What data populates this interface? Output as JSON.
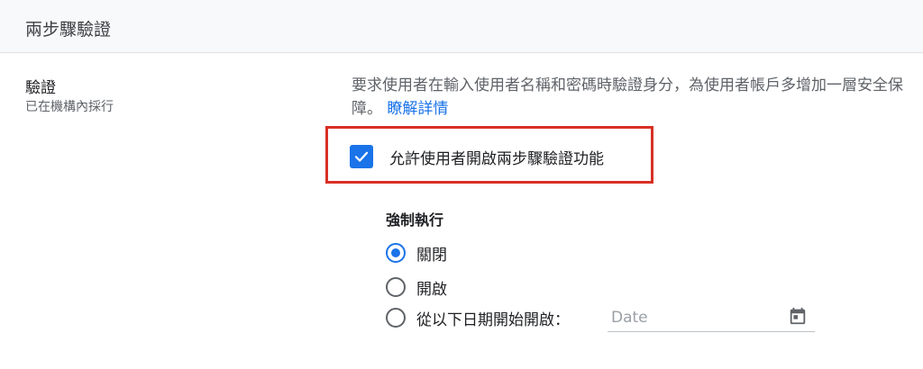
{
  "header": {
    "title": "兩步驟驗證"
  },
  "setting": {
    "name": "驗證",
    "status": "已在機構內採行",
    "description": "要求使用者在輸入使用者名稱和密碼時驗證身分，為使用者帳戶多增加一層安全保障。",
    "learn_more": "瞭解詳情"
  },
  "allow_checkbox": {
    "label": "允許使用者開啟兩步驟驗證功能",
    "checked": true
  },
  "enforcement": {
    "title": "強制執行",
    "options": [
      {
        "label": "關閉",
        "selected": true
      },
      {
        "label": "開啟",
        "selected": false
      },
      {
        "label": "從以下日期開始開啟：",
        "selected": false
      }
    ],
    "date_placeholder": "Date"
  },
  "colors": {
    "accent": "#1a73e8",
    "highlight": "#d93025"
  },
  "icons": {
    "checkbox": "checkmark-icon",
    "calendar": "calendar-icon"
  }
}
